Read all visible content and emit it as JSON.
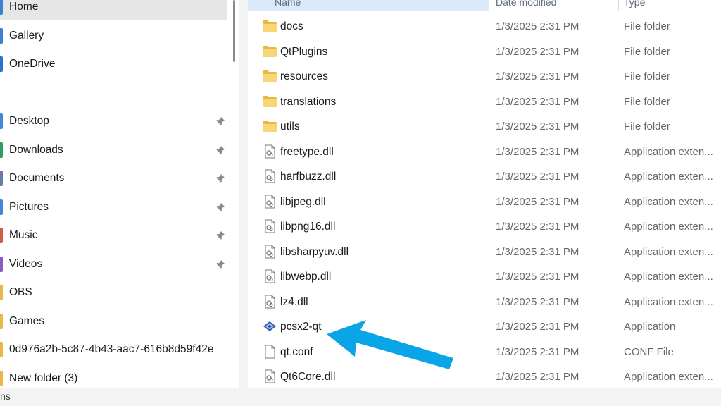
{
  "sidebar": {
    "items": [
      {
        "label": "Home",
        "pinned": false,
        "edge": "#3f7fd1"
      },
      {
        "label": "Gallery",
        "pinned": false,
        "edge": "#3f7fd1"
      },
      {
        "label": "OneDrive",
        "pinned": false,
        "edge": "#2b73c9"
      },
      {
        "label": "Desktop",
        "pinned": true,
        "edge": "#3f8ad8"
      },
      {
        "label": "Downloads",
        "pinned": true,
        "edge": "#2e9d5e"
      },
      {
        "label": "Documents",
        "pinned": true,
        "edge": "#6b7ba8"
      },
      {
        "label": "Pictures",
        "pinned": true,
        "edge": "#3f8ad8"
      },
      {
        "label": "Music",
        "pinned": true,
        "edge": "#d35a4a"
      },
      {
        "label": "Videos",
        "pinned": true,
        "edge": "#8a5ac8"
      },
      {
        "label": "OBS",
        "pinned": false,
        "edge": "#e8b84a"
      },
      {
        "label": "Games",
        "pinned": false,
        "edge": "#e8b84a"
      },
      {
        "label": "0d976a2b-5c87-4b43-aac7-616b8d59f42e",
        "pinned": false,
        "edge": "#e8b84a"
      },
      {
        "label": "New folder (3)",
        "pinned": false,
        "edge": "#e8b84a"
      }
    ]
  },
  "columns": {
    "name": "Name",
    "date": "Date modified",
    "type": "Type"
  },
  "files": [
    {
      "name": "docs",
      "date": "1/3/2025 2:31 PM",
      "type": "File folder",
      "icon": "folder-icon"
    },
    {
      "name": "QtPlugins",
      "date": "1/3/2025 2:31 PM",
      "type": "File folder",
      "icon": "folder-icon"
    },
    {
      "name": "resources",
      "date": "1/3/2025 2:31 PM",
      "type": "File folder",
      "icon": "folder-icon"
    },
    {
      "name": "translations",
      "date": "1/3/2025 2:31 PM",
      "type": "File folder",
      "icon": "folder-icon"
    },
    {
      "name": "utils",
      "date": "1/3/2025 2:31 PM",
      "type": "File folder",
      "icon": "folder-icon"
    },
    {
      "name": "freetype.dll",
      "date": "1/3/2025 2:31 PM",
      "type": "Application exten...",
      "icon": "dll-file-icon"
    },
    {
      "name": "harfbuzz.dll",
      "date": "1/3/2025 2:31 PM",
      "type": "Application exten...",
      "icon": "dll-file-icon"
    },
    {
      "name": "libjpeg.dll",
      "date": "1/3/2025 2:31 PM",
      "type": "Application exten...",
      "icon": "dll-file-icon"
    },
    {
      "name": "libpng16.dll",
      "date": "1/3/2025 2:31 PM",
      "type": "Application exten...",
      "icon": "dll-file-icon"
    },
    {
      "name": "libsharpyuv.dll",
      "date": "1/3/2025 2:31 PM",
      "type": "Application exten...",
      "icon": "dll-file-icon"
    },
    {
      "name": "libwebp.dll",
      "date": "1/3/2025 2:31 PM",
      "type": "Application exten...",
      "icon": "dll-file-icon"
    },
    {
      "name": "lz4.dll",
      "date": "1/3/2025 2:31 PM",
      "type": "Application exten...",
      "icon": "dll-file-icon"
    },
    {
      "name": "pcsx2-qt",
      "date": "1/3/2025 2:31 PM",
      "type": "Application",
      "icon": "pcsx2-app-icon"
    },
    {
      "name": "qt.conf",
      "date": "1/3/2025 2:31 PM",
      "type": "CONF File",
      "icon": "text-file-icon"
    },
    {
      "name": "Qt6Core.dll",
      "date": "1/3/2025 2:31 PM",
      "type": "Application exten...",
      "icon": "dll-file-icon"
    }
  ],
  "statusbar": {
    "text": "ns"
  },
  "annotation": {
    "color": "#0aa5e6"
  }
}
